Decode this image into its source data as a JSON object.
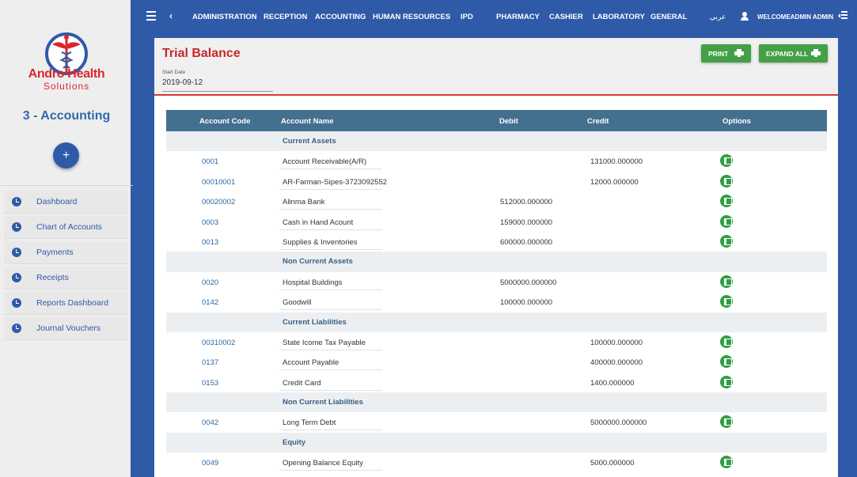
{
  "sidebar": {
    "logo_line1": "Andro Health",
    "logo_line2": "Solutions",
    "module_title": "3 - Accounting",
    "add_label": "+",
    "items": [
      {
        "label": "Dashboard"
      },
      {
        "label": "Chart of Accounts"
      },
      {
        "label": "Payments"
      },
      {
        "label": "Receipts"
      },
      {
        "label": "Reports Dashboard"
      },
      {
        "label": "Journal Vouchers"
      }
    ]
  },
  "topbar": {
    "back": "‹",
    "menu": [
      "ADMINISTRATION",
      "RECEPTION",
      "ACCOUNTING",
      "HUMAN RESOURCES",
      "IPD",
      "PHARMACY",
      "CASHIER",
      "LABORATORY",
      "GENERAL"
    ],
    "language": "عربي",
    "user": "WELCOMEADMIN ADMIN"
  },
  "page": {
    "title": "Trial Balance",
    "start_date_label": "Start Date",
    "start_date": "2019-09-12",
    "print_label": "PRINT",
    "expand_label": "EXPAND ALL"
  },
  "table": {
    "headers": {
      "code": "Account Code",
      "name": "Account Name",
      "debit": "Debit",
      "credit": "Credit",
      "options": "Options"
    },
    "rows": [
      {
        "group": "Current Assets"
      },
      {
        "code": "0001",
        "name": "Account Receivable(A/R)",
        "debit": "",
        "credit": "131000.000000"
      },
      {
        "code": "00010001",
        "name": "AR-Farman-Sipes-3723092552",
        "debit": "",
        "credit": "12000.000000"
      },
      {
        "code": "00020002",
        "name": "Alinma Bank",
        "debit": "512000.000000",
        "credit": ""
      },
      {
        "code": "0003",
        "name": "Cash in Hand Acount",
        "debit": "159000.000000",
        "credit": ""
      },
      {
        "code": "0013",
        "name": "Supplies & Inventories",
        "debit": "600000.000000",
        "credit": ""
      },
      {
        "group": "Non Current Assets"
      },
      {
        "code": "0020",
        "name": "Hospital Buildings",
        "debit": "5000000.000000",
        "credit": ""
      },
      {
        "code": "0142",
        "name": "Goodwill",
        "debit": "100000.000000",
        "credit": ""
      },
      {
        "group": "Current Liabilities"
      },
      {
        "code": "00310002",
        "name": "State Icome Tax Payable",
        "debit": "",
        "credit": "100000.000000"
      },
      {
        "code": "0137",
        "name": "Account Payable",
        "debit": "",
        "credit": "400000.000000"
      },
      {
        "code": "0153",
        "name": "Credit Card",
        "debit": "",
        "credit": "1400.000000"
      },
      {
        "group": "Non Current Liabilities"
      },
      {
        "code": "0042",
        "name": "Long Term Debt",
        "debit": "",
        "credit": "5000000.000000"
      },
      {
        "group": "Equity"
      },
      {
        "code": "0049",
        "name": "Opening Balance Equity",
        "debit": "",
        "credit": "5000.000000"
      }
    ]
  },
  "colors": {
    "primary": "#2f5aa8",
    "accent": "#c62828",
    "button": "#43a047",
    "table_header": "#44708f"
  }
}
